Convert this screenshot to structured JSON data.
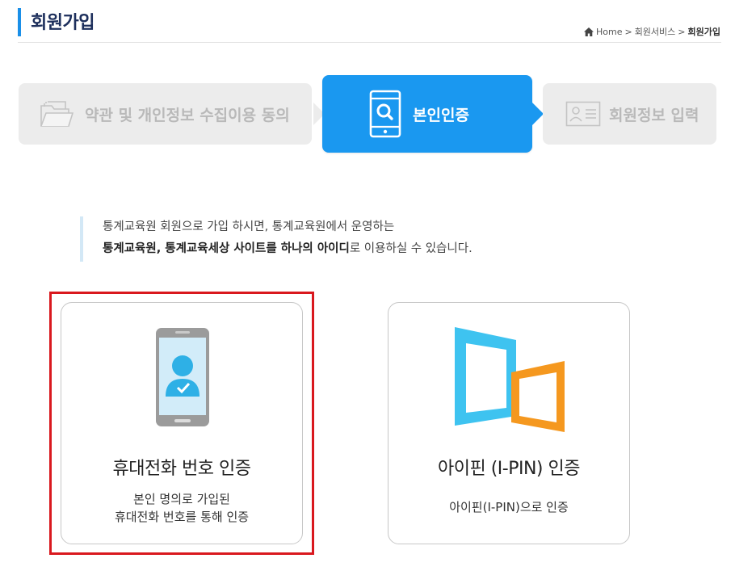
{
  "header": {
    "title": "회원가입",
    "breadcrumb": {
      "home": "Home",
      "sep1": ">",
      "section": "회원서비스",
      "sep2": ">",
      "current": "회원가입"
    }
  },
  "steps": [
    {
      "label": "약관 및 개인정보 수집이용 동의",
      "icon": "folder-icon",
      "state": "inactive"
    },
    {
      "label": "본인인증",
      "icon": "phone-search-icon",
      "state": "active"
    },
    {
      "label": "회원정보 입력",
      "icon": "id-card-icon",
      "state": "inactive"
    }
  ],
  "intro": {
    "line1": "통계교육원 회원으로 가입 하시면, 통계교육원에서 운영하는",
    "line2_bold": "통계교육원, 통계교육세상 사이트를 하나의 아이디",
    "line2_rest": "로 이용하실 수 있습니다."
  },
  "cards": [
    {
      "title": "휴대전화 번호 인증",
      "desc1": "본인 명의로 가입된",
      "desc2": "휴대전화 번호를 통해 인증",
      "icon": "mobile-user-icon",
      "selected": true
    },
    {
      "title": "아이핀 (I-PIN) 인증",
      "desc1": "아이핀(I-PIN)으로 인증",
      "icon": "ipin-logo-icon",
      "selected": false
    }
  ],
  "colors": {
    "accent": "#1a98f0",
    "title": "#1d2f5c",
    "highlight": "#d9181e",
    "ipin_blue": "#3ec3f0",
    "ipin_orange": "#f5981f"
  }
}
